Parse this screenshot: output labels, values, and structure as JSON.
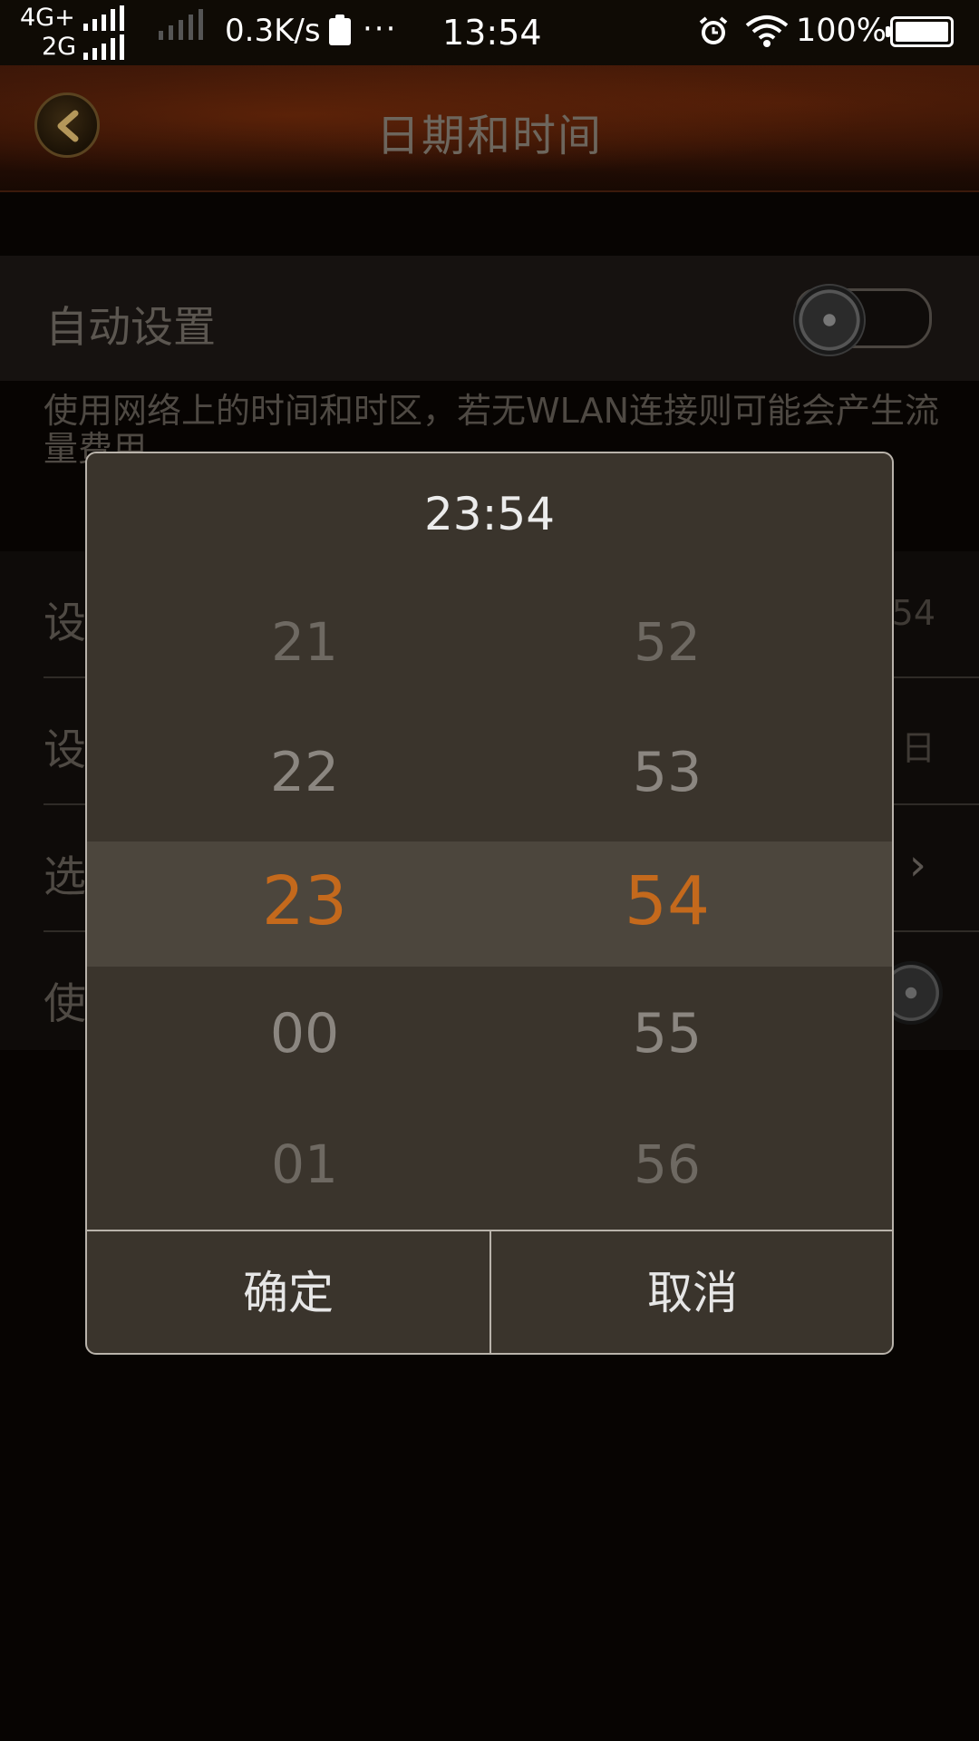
{
  "status_bar": {
    "network_primary": "4G+",
    "network_secondary": "2G",
    "speed": "0.3K/s",
    "more": "···",
    "time": "13:54",
    "battery": "100%"
  },
  "header": {
    "title": "日期和时间",
    "back_icon": "chevron-left-icon"
  },
  "settings": {
    "auto_label": "自动设置",
    "auto_enabled": false,
    "auto_description": "使用网络上的时间和时区，若无WLAN连接则可能会产生流量费用",
    "rows": [
      {
        "label": "设",
        "value": "54"
      },
      {
        "label": "设",
        "value": "日"
      },
      {
        "label": "选",
        "value": "›"
      },
      {
        "label": "使",
        "value": ""
      }
    ]
  },
  "dialog": {
    "title": "23:54",
    "hours": [
      "21",
      "22",
      "23",
      "00",
      "01"
    ],
    "minutes": [
      "52",
      "53",
      "54",
      "55",
      "56"
    ],
    "selected_hour": "23",
    "selected_minute": "54",
    "ok_label": "确定",
    "cancel_label": "取消",
    "accent_color": "#c4691c"
  }
}
